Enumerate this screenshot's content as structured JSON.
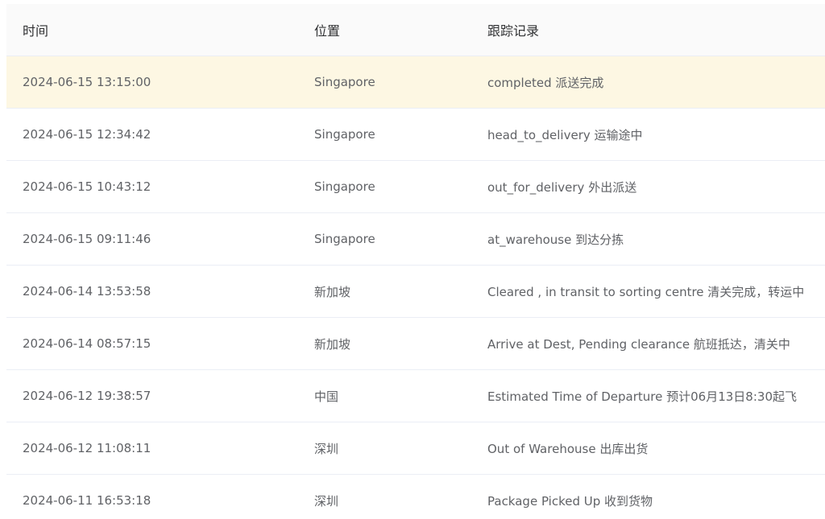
{
  "table": {
    "columns": {
      "time": "时间",
      "location": "位置",
      "record": "跟踪记录"
    },
    "rows": [
      {
        "time": "2024-06-15 13:15:00",
        "location": "Singapore",
        "record": "completed 派送完成",
        "highlighted": true
      },
      {
        "time": "2024-06-15 12:34:42",
        "location": "Singapore",
        "record": "head_to_delivery 运输途中"
      },
      {
        "time": "2024-06-15 10:43:12",
        "location": "Singapore",
        "record": "out_for_delivery 外出派送"
      },
      {
        "time": "2024-06-15 09:11:46",
        "location": "Singapore",
        "record": "at_warehouse 到达分拣"
      },
      {
        "time": "2024-06-14 13:53:58",
        "location": "新加坡",
        "record": "Cleared , in transit to sorting centre 清关完成，转运中"
      },
      {
        "time": "2024-06-14 08:57:15",
        "location": "新加坡",
        "record": "Arrive at Dest, Pending clearance 航班抵达，清关中"
      },
      {
        "time": "2024-06-12 19:38:57",
        "location": "中国",
        "record": "Estimated Time of Departure 预计06月13日8:30起飞"
      },
      {
        "time": "2024-06-12 11:08:11",
        "location": "深圳",
        "record": "Out of Warehouse 出库出货"
      },
      {
        "time": "2024-06-11 16:53:18",
        "location": "深圳",
        "record": "Package Picked Up 收到货物"
      }
    ]
  },
  "colors": {
    "header_bg": "#fafafa",
    "highlight_row_bg": "#fdf7e3",
    "border": "#ebeef5",
    "text": "#606266",
    "header_text": "#303133"
  }
}
